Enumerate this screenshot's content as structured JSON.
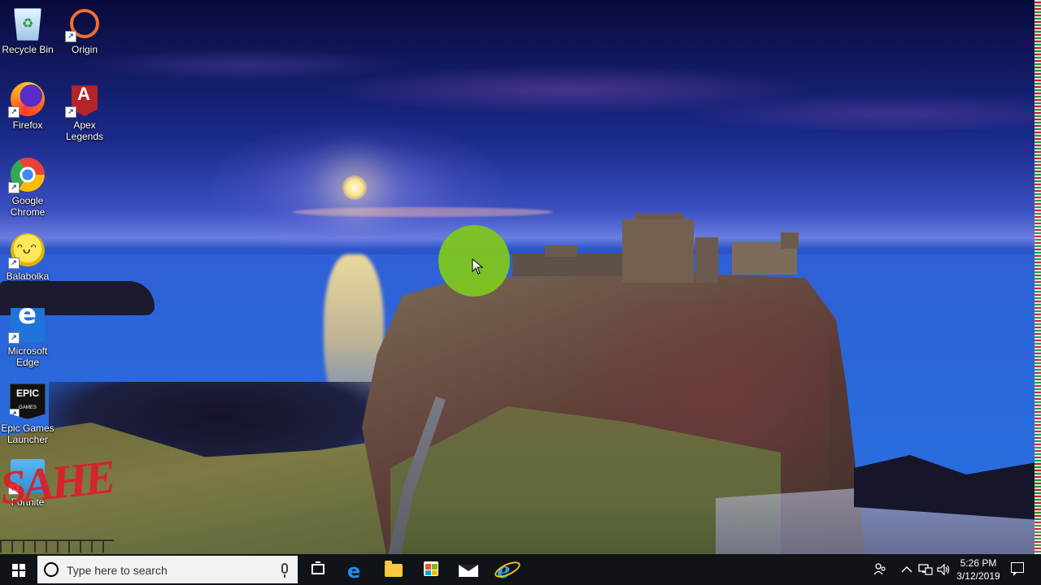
{
  "desktop": {
    "icons": [
      {
        "label": "Recycle Bin",
        "icon": "recycle-bin-icon"
      },
      {
        "label": "Origin",
        "icon": "origin-icon"
      },
      {
        "label": "Firefox",
        "icon": "firefox-icon"
      },
      {
        "label": "Apex Legends",
        "icon": "apex-legends-icon"
      },
      {
        "label": "Google Chrome",
        "icon": "chrome-icon"
      },
      {
        "label": "Balabolka",
        "icon": "balabolka-icon"
      },
      {
        "label": "Microsoft Edge",
        "icon": "edge-icon"
      },
      {
        "label": "Epic Games Launcher",
        "icon": "epic-games-icon"
      },
      {
        "label": "Fortnite",
        "icon": "fortnite-icon"
      }
    ],
    "epic_logo_text": "EPIC",
    "epic_logo_sub": "GAMES",
    "watermark": "SAHE",
    "cursor_highlight_color": "#7dc520"
  },
  "taskbar": {
    "search_placeholder": "Type here to search",
    "pinned": [
      "task-view",
      "microsoft-edge",
      "file-explorer",
      "microsoft-store",
      "mail",
      "internet-explorer"
    ],
    "clock_time": "5:26 PM",
    "clock_date": "3/12/2019",
    "background": "#101418"
  }
}
